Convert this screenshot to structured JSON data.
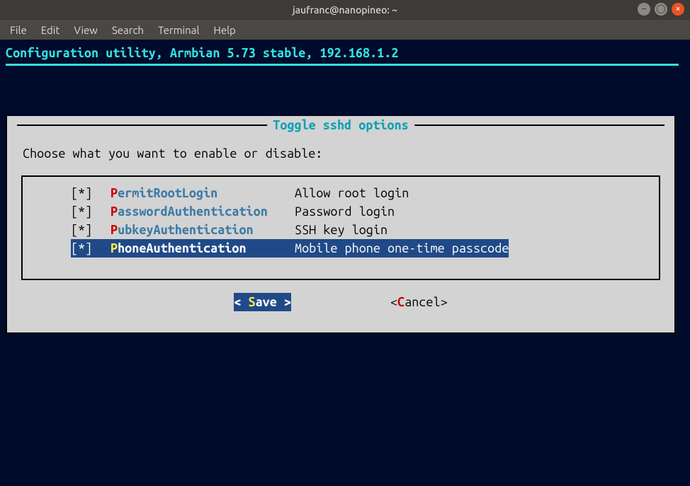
{
  "window": {
    "title": "jaufranc@nanopineo: ~"
  },
  "menubar": {
    "items": [
      "File",
      "Edit",
      "View",
      "Search",
      "Terminal",
      "Help"
    ]
  },
  "header": "Configuration utility, Armbian 5.73 stable, 192.168.1.2",
  "dialog": {
    "title": "Toggle sshd options",
    "prompt": "Choose what you want to enable or disable:",
    "options": [
      {
        "checked": "[*]",
        "hotkey": "P",
        "rest": "ermitRootLogin",
        "desc": "Allow root login",
        "selected": false
      },
      {
        "checked": "[*]",
        "hotkey": "P",
        "rest": "asswordAuthentication",
        "desc": "Password login",
        "selected": false
      },
      {
        "checked": "[*]",
        "hotkey": "P",
        "rest": "ubkeyAuthentication",
        "desc": "SSH key login",
        "selected": false
      },
      {
        "checked": "[*]",
        "hotkey": "P",
        "rest": "honeAuthentication",
        "desc": "Mobile phone one-time passcode",
        "selected": true
      }
    ],
    "buttons": {
      "save": {
        "left": "< ",
        "hotkey": "S",
        "rest": "ave >"
      },
      "cancel": {
        "left": "<",
        "hotkey": "C",
        "rest": "ancel>"
      }
    }
  }
}
